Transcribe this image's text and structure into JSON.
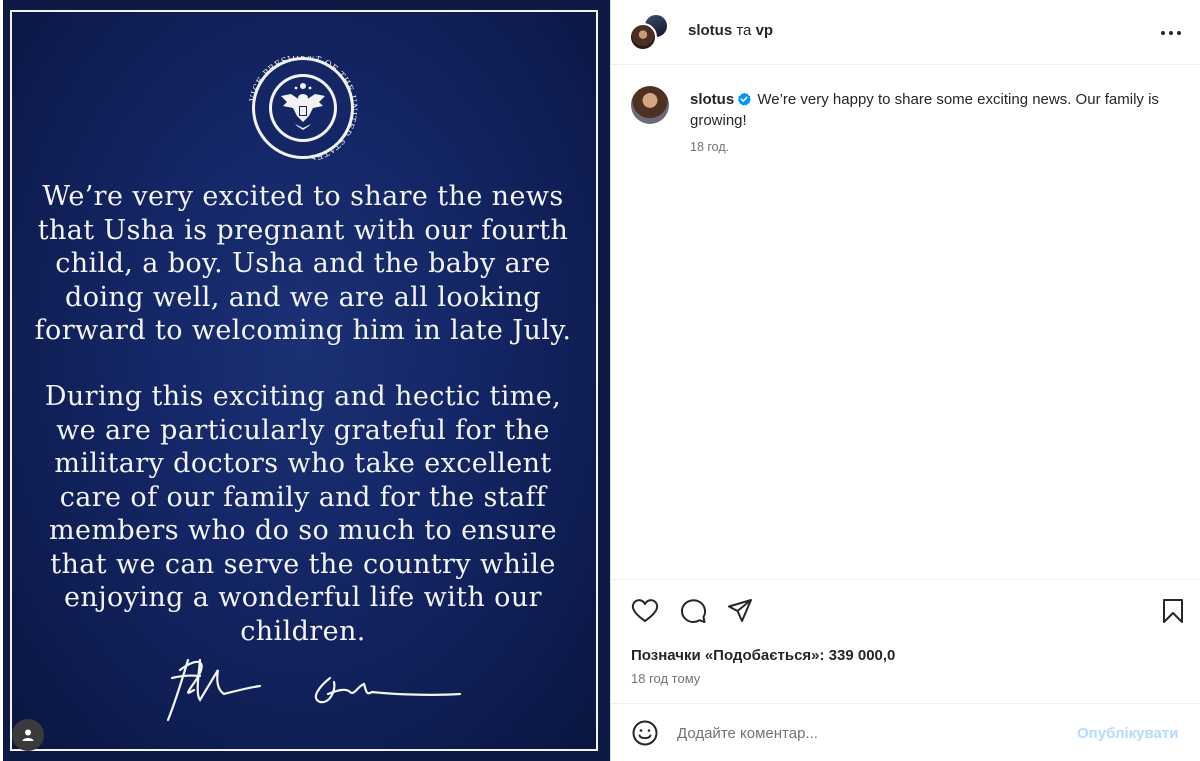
{
  "image": {
    "seal_text": "VICE PRESIDENT OF THE UNITED STATES",
    "letter_paragraph_1": "We’re very excited to share the news that Usha is pregnant with our fourth child, a boy. Usha and the baby are doing well, and we are all looking forward to welcoming him in late July.",
    "letter_paragraph_2": "During this exciting and hectic time, we are particularly grateful for the military doctors who take excellent care of our family and for the staff members who do so much to ensure that we can serve the country while enjoying a wonderful life with our children.",
    "signature_icon": "signature-handwritten",
    "avatar_icon": "person-icon"
  },
  "header": {
    "username": "slotus",
    "separator": "та",
    "collaborator": "vp",
    "more_icon": "more-horizontal-icon"
  },
  "caption": {
    "username": "slotus",
    "text": "We’re very happy to share some exciting news. Our family is growing!",
    "time": "18 год.",
    "verified_color": "#0095f6"
  },
  "actions": {
    "like_icon": "heart-icon",
    "comment_icon": "comment-icon",
    "share_icon": "send-icon",
    "save_icon": "bookmark-icon"
  },
  "likes_text": "Позначки «Подобається»: 339 000,0",
  "post_time": "18 год тому",
  "add_comment": {
    "placeholder": "Додайте коментар...",
    "publish_label": "Опублікувати",
    "emoji_icon": "emoji-icon",
    "publish_color": "#b3dbff"
  }
}
